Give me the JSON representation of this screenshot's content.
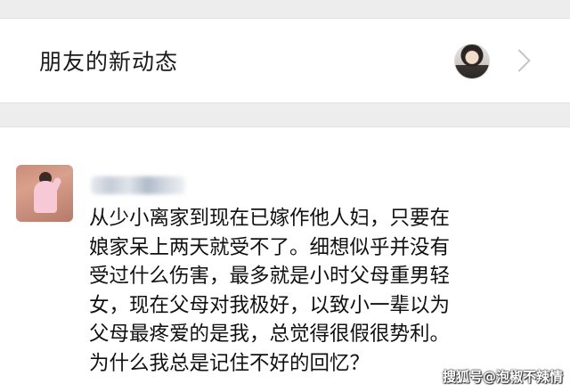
{
  "friends_updates": {
    "title": "朋友的新动态"
  },
  "post": {
    "lines": [
      "从少小离家到现在已嫁作他人妇，只要在",
      "娘家呆上两天就受不了。细想似乎并没有",
      "受过什么伤害，最多就是小时父母重男轻",
      "女，现在父母对我极好，以致小一辈以为",
      "父母最疼爱的是我，总觉得很假很势利。",
      "为什么我总是记住不好的回忆？"
    ]
  },
  "watermark": {
    "text": "搜狐号@泡椒不辣情"
  }
}
